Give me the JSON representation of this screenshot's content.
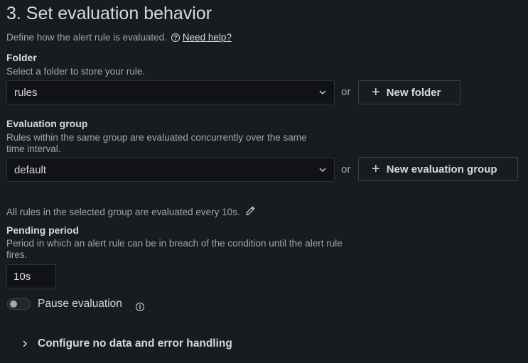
{
  "section": {
    "title": "3. Set evaluation behavior",
    "description": "Define how the alert rule is evaluated.",
    "help_link": "Need help?"
  },
  "folder": {
    "label": "Folder",
    "description": "Select a folder to store your rule.",
    "value": "rules",
    "or_text": "or",
    "new_button": "New folder"
  },
  "group": {
    "label": "Evaluation group",
    "description_line1": "Rules within the same group are evaluated concurrently over the same",
    "description_line2": "time interval.",
    "value": "default",
    "or_text": "or",
    "new_button": "New evaluation group",
    "interval_text": "All rules in the selected group are evaluated every 10s."
  },
  "pending": {
    "label": "Pending period",
    "description_line1": "Period in which an alert rule can be in breach of the condition until the alert rule",
    "description_line2": "fires.",
    "value": "10s"
  },
  "pause": {
    "label": "Pause evaluation",
    "enabled": false
  },
  "advanced": {
    "label": "Configure no data and error handling"
  }
}
